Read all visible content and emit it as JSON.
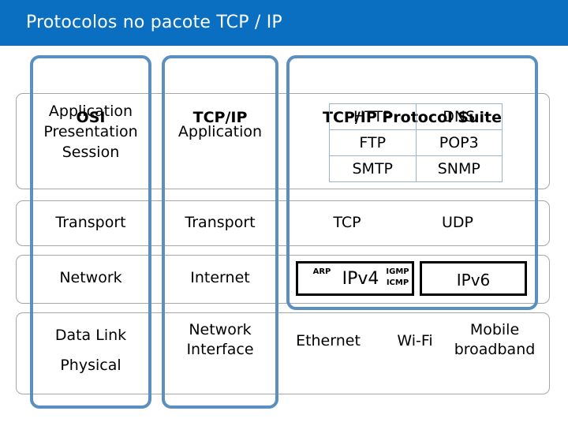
{
  "title": "Protocolos no pacote TCP / IP",
  "accent_color": "#0a6fc0",
  "column_border_color": "#5b8fc0",
  "row_border_color": "#a6a6a6",
  "headers": {
    "osi": "OSI",
    "tcpip": "TCP/IP",
    "suite": "TCP/IP Protocol Suite"
  },
  "rows": {
    "application": {
      "osi": "Application\nPresentation\nSession",
      "osi_lines": [
        "Application",
        "Presentation",
        "Session"
      ],
      "tcpip": "Application",
      "protocols": [
        [
          "HTTP",
          "DNS"
        ],
        [
          "FTP",
          "POP3"
        ],
        [
          "SMTP",
          "SNMP"
        ]
      ]
    },
    "transport": {
      "osi": "Transport",
      "tcpip": "Transport",
      "tcp": "TCP",
      "udp": "UDP"
    },
    "network": {
      "osi": "Network",
      "tcpip": "Internet",
      "ipv4_box": {
        "left_label": "ARP",
        "main_label": "IPv4",
        "right_labels": [
          "IGMP",
          "ICMP"
        ]
      },
      "ipv6_box": "IPv6"
    },
    "datalink": {
      "osi_lines": [
        "Data Link",
        "Physical"
      ],
      "tcpip_lines": [
        "Network",
        "Interface"
      ],
      "ethernet": "Ethernet",
      "wifi": "Wi-Fi",
      "mobile_lines": [
        "Mobile",
        "broadband"
      ]
    }
  }
}
